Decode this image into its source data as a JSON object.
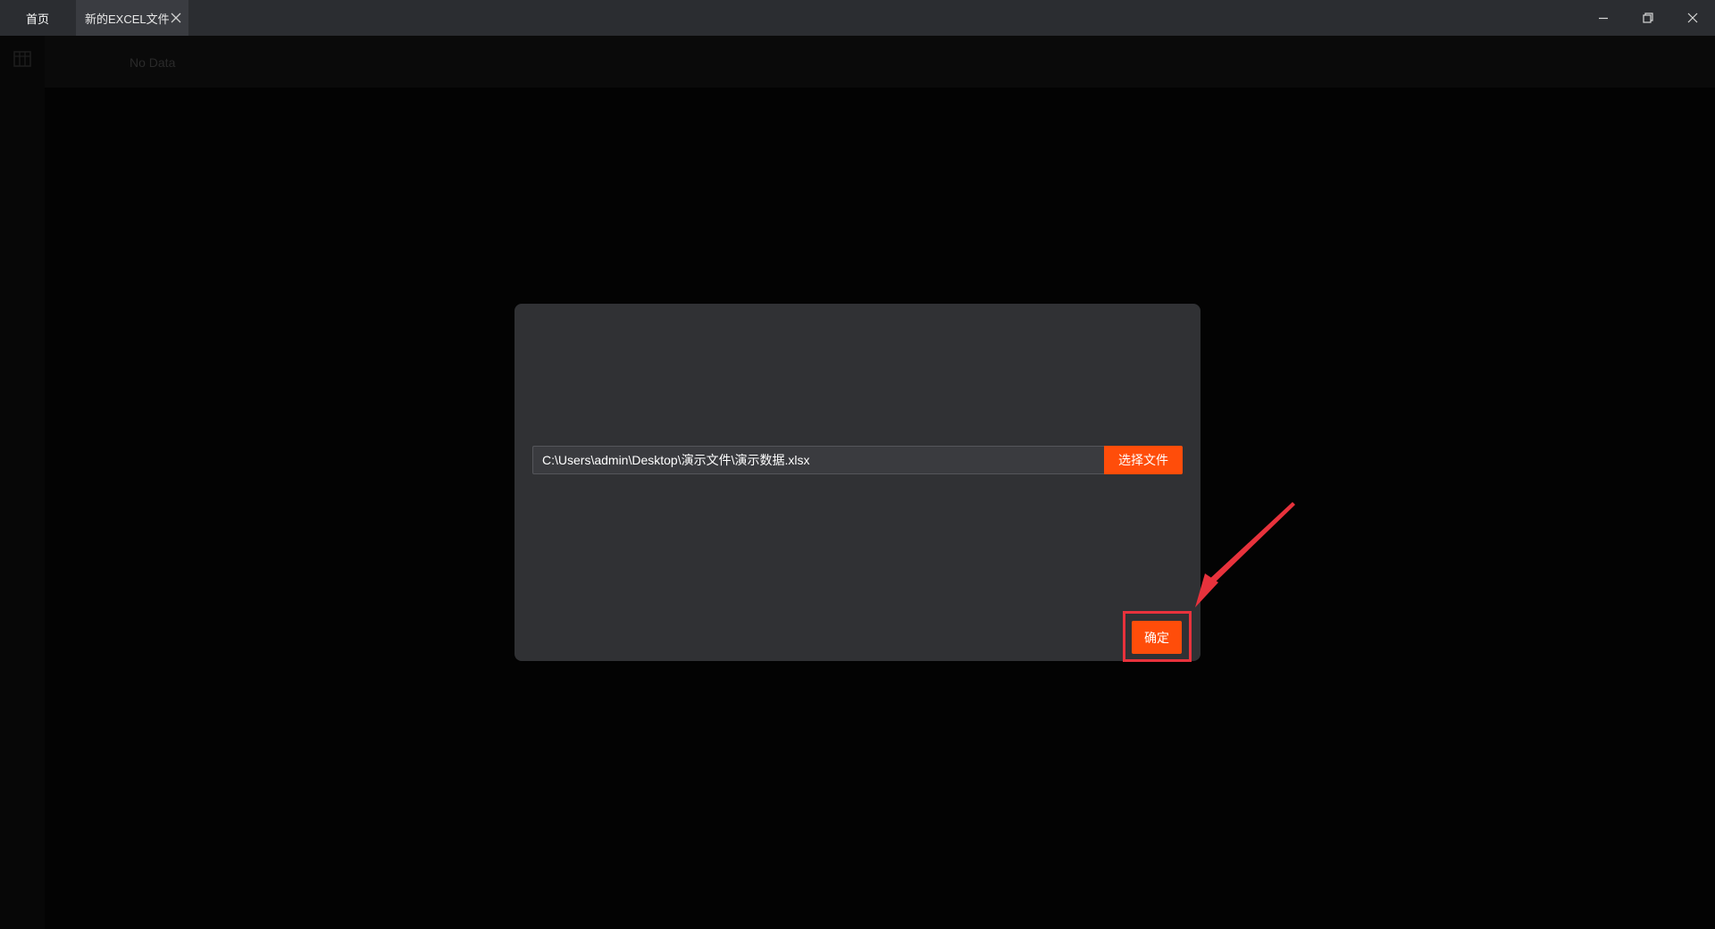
{
  "titlebar": {
    "tabs": [
      {
        "label": "首页",
        "active": false
      },
      {
        "label": "新的EXCEL文件",
        "active": true
      }
    ],
    "window_controls": [
      "minimize-icon",
      "restore-icon",
      "close-icon"
    ]
  },
  "background": {
    "empty_text": "No Data",
    "icon": "table-icon"
  },
  "dialog": {
    "file_path": "C:\\Users\\admin\\Desktop\\演示文件\\演示数据.xlsx",
    "choose_file_label": "选择文件",
    "confirm_label": "确定"
  },
  "colors": {
    "accent": "#ff4d0a",
    "annotation": "#e8323c",
    "dialog_bg": "#303134",
    "titlebar_bg": "#2b2d31"
  }
}
